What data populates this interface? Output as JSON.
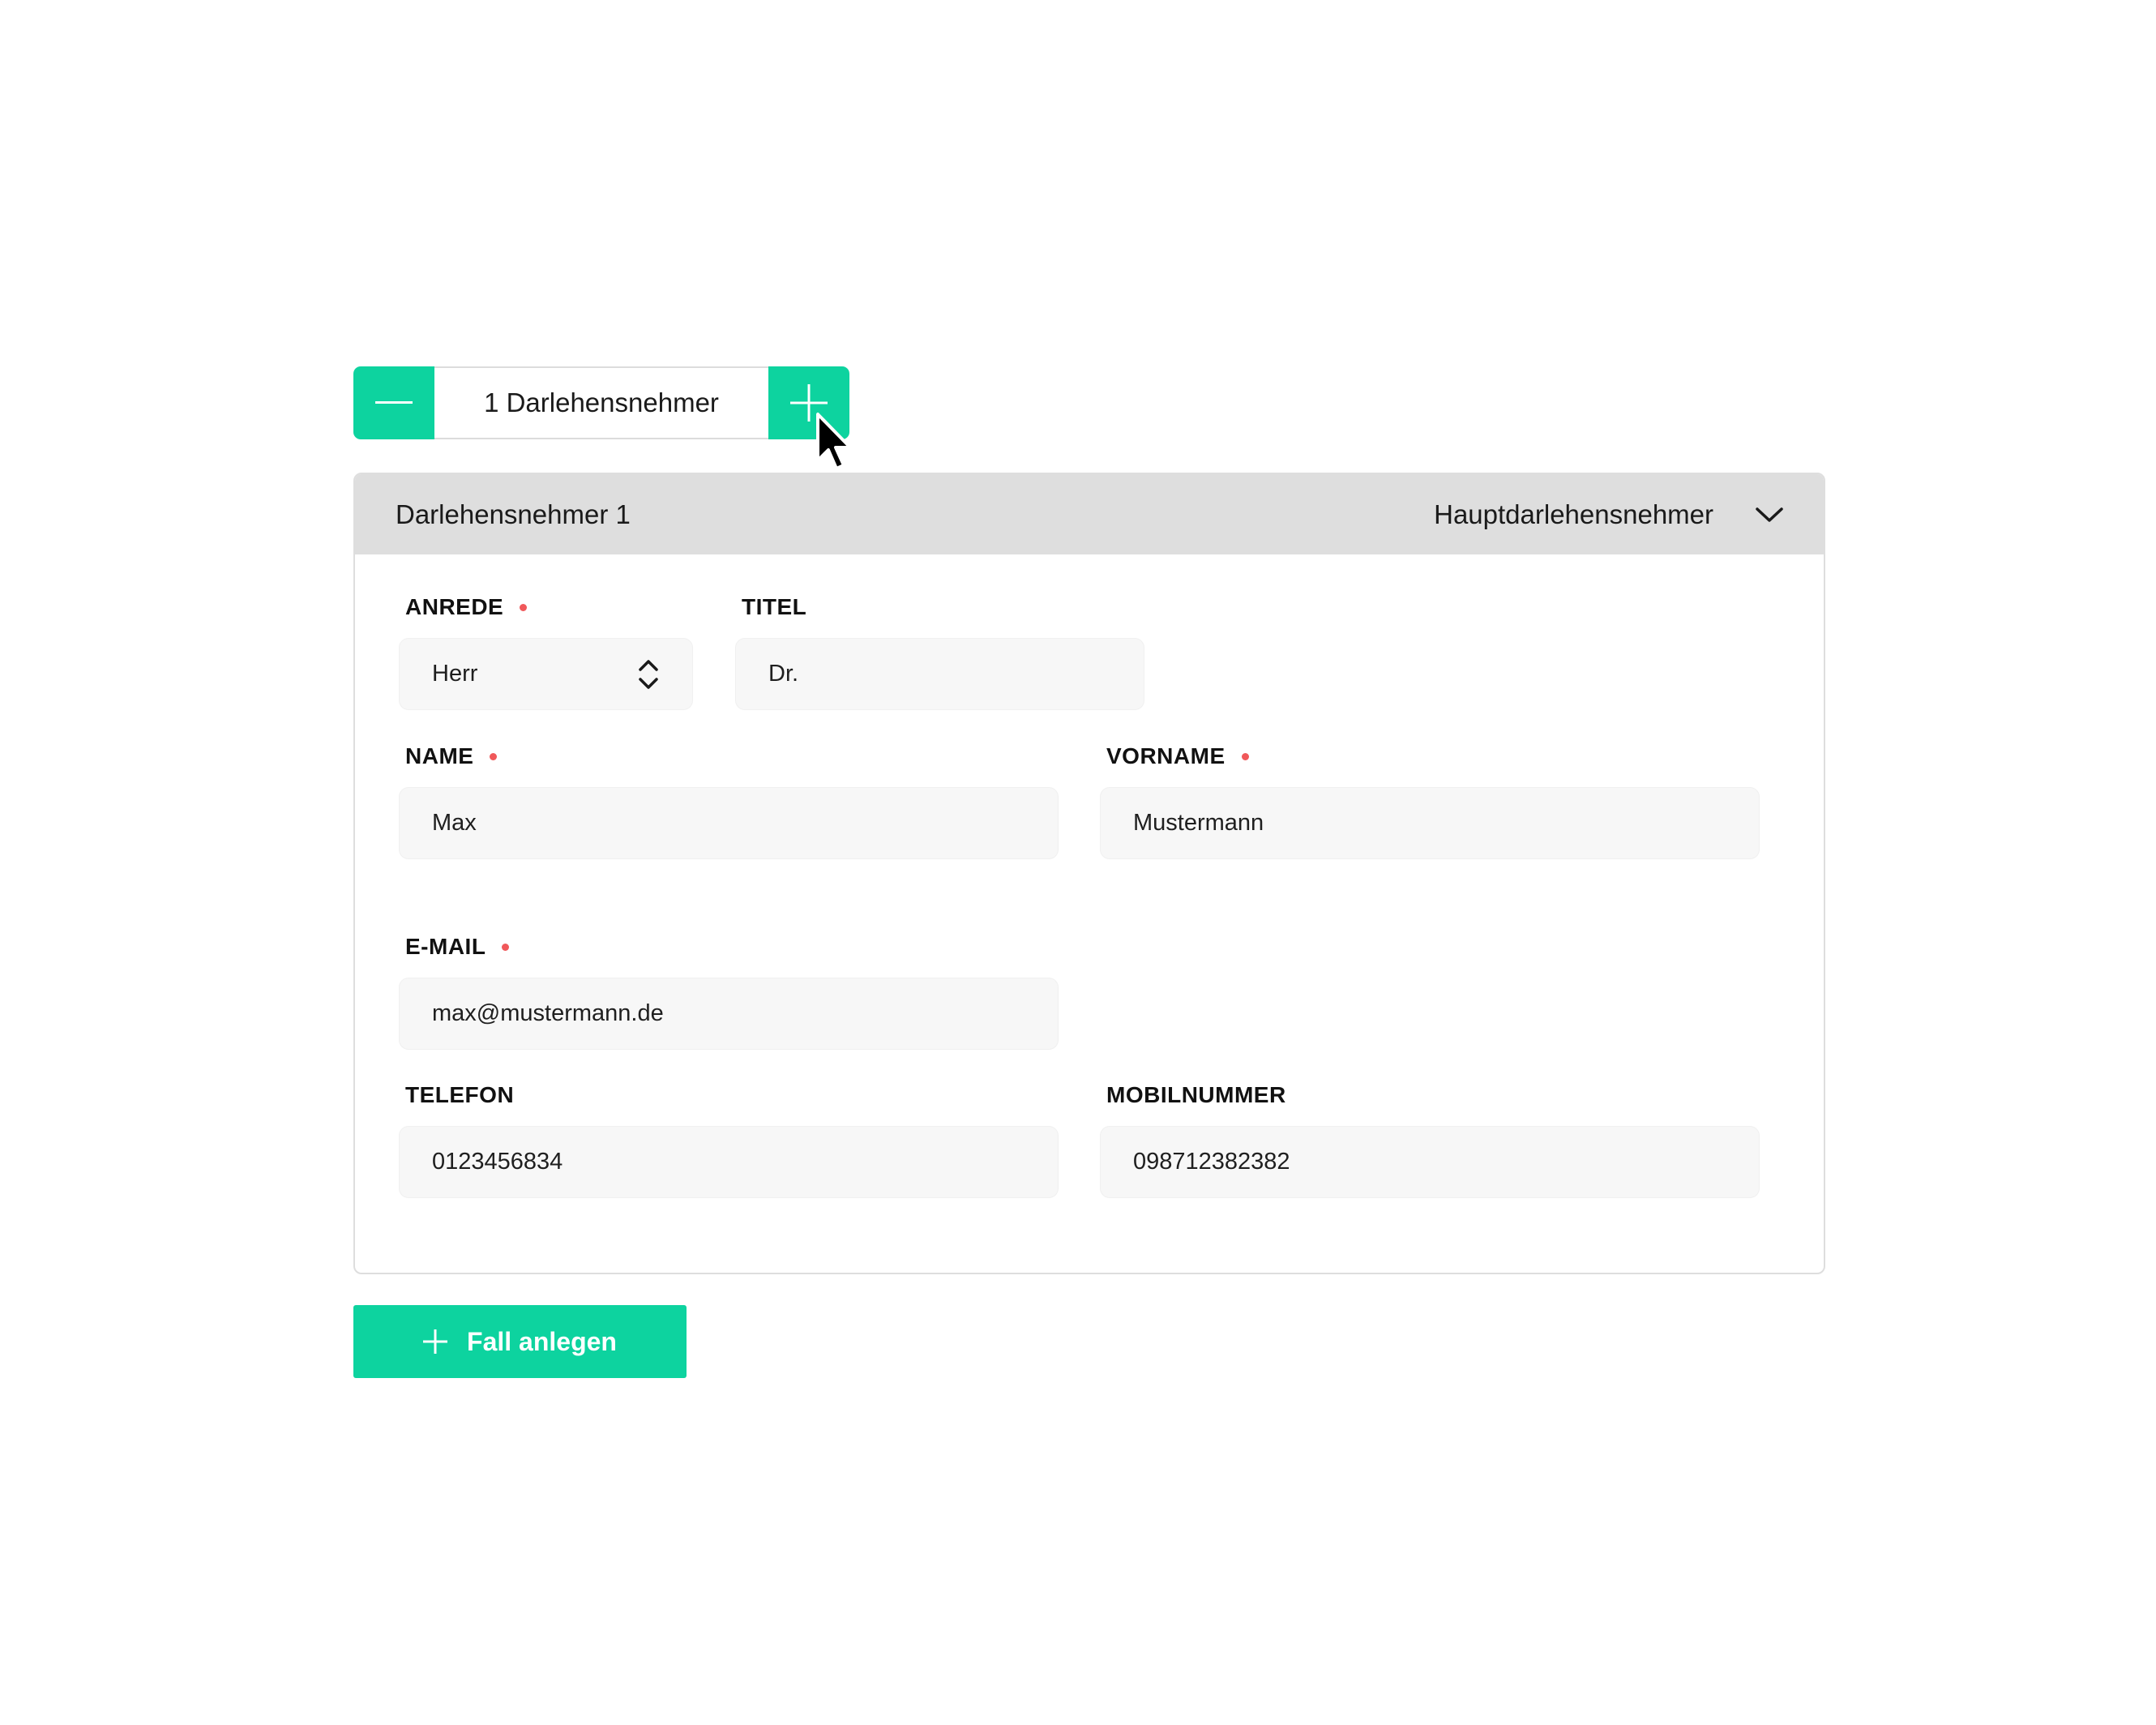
{
  "stepper": {
    "label": "1 Darlehensnehmer",
    "minus_icon": "minus-icon",
    "plus_icon": "plus-icon"
  },
  "card": {
    "header": {
      "title": "Darlehensnehmer 1",
      "role": "Hauptdarlehensnehmer",
      "toggle_icon": "chevron-down-icon"
    },
    "fields": {
      "anrede": {
        "label": "ANREDE",
        "value": "Herr",
        "required": true
      },
      "titel": {
        "label": "TITEL",
        "value": "Dr.",
        "required": false
      },
      "name": {
        "label": "NAME",
        "value": "Max",
        "required": true
      },
      "vorname": {
        "label": "VORNAME",
        "value": "Mustermann",
        "required": true
      },
      "email": {
        "label": "E-MAIL",
        "value": "max@mustermann.de",
        "required": true
      },
      "telefon": {
        "label": "TELEFON",
        "value": "0123456834",
        "required": false
      },
      "mobilnummer": {
        "label": "MOBILNUMMER",
        "value": "098712382382",
        "required": false
      }
    }
  },
  "actions": {
    "create_case_label": "Fall anlegen"
  },
  "colors": {
    "accent": "#0dd39f",
    "header_bg": "#dedede",
    "field_bg": "#f7f7f7",
    "required_dot": "#f0585a"
  }
}
